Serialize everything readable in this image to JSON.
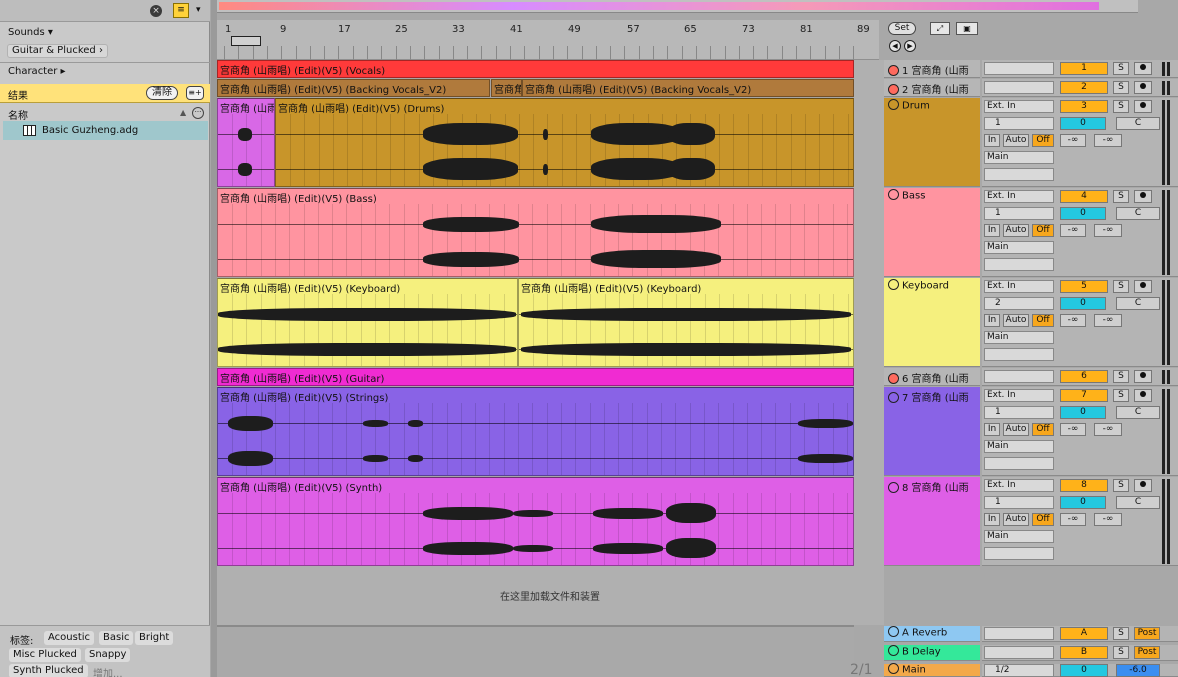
{
  "sidebar": {
    "category_sounds": "Sounds ▾",
    "category_guitar": "Guitar & Plucked ›",
    "category_character": "Character ▸",
    "results_label": "结果",
    "clear_label": "清除",
    "name_header": "名称",
    "result_file": "Basic Guzheng.adg",
    "tags_label": "标签:",
    "tags": [
      "Acoustic",
      "Basic",
      "Bright",
      "Misc Plucked",
      "Snappy",
      "Synth Plucked"
    ],
    "add_tag": "增加..."
  },
  "ruler": {
    "bars": [
      "1",
      "9",
      "17",
      "25",
      "33",
      "41",
      "49",
      "57",
      "65",
      "73",
      "81",
      "89"
    ],
    "set_label": "Set"
  },
  "drop_hint": "在这里加载文件和装置",
  "tracks": [
    {
      "num": "1",
      "header": "1 宫商角 (山雨",
      "clips": [
        "宫商角 (山雨唱) (Edit)(V5) (Vocals)"
      ],
      "vol": "1",
      "color": "#ff3a3a"
    },
    {
      "num": "2",
      "header": "2 宫商角 (山雨",
      "clips": [
        "宫商角 (山雨唱) (Edit)(V5) (Backing Vocals_V2)",
        "宫商角",
        "宫商角 (山雨唱) (Edit)(V5) (Backing Vocals_V2)"
      ],
      "vol": "2",
      "color": "#b07a3c"
    },
    {
      "num": "3",
      "header": "Drum",
      "clips": [
        "宫商角 (山雨",
        "宫商角 (山雨唱) (Edit)(V5) (Drums)"
      ],
      "vol": "3",
      "input": "Ext. In",
      "channel": "1",
      "color": "#c8952a"
    },
    {
      "num": "4",
      "header": "Bass",
      "clips": [
        "宫商角 (山雨唱) (Edit)(V5) (Bass)"
      ],
      "vol": "4",
      "input": "Ext. In",
      "channel": "1",
      "color": "#ff94a0"
    },
    {
      "num": "5",
      "header": "Keyboard",
      "clips": [
        "宫商角 (山雨唱) (Edit)(V5) (Keyboard)",
        "宫商角 (山雨唱) (Edit)(V5) (Keyboard)"
      ],
      "vol": "5",
      "input": "Ext. In",
      "channel": "2",
      "color": "#f5f07e"
    },
    {
      "num": "6",
      "header": "6 宫商角 (山雨",
      "clips": [
        "宫商角 (山雨唱) (Edit)(V5) (Guitar)"
      ],
      "vol": "6",
      "color": "#f02bd2"
    },
    {
      "num": "7",
      "header": "7 宫商角 (山雨",
      "clips": [
        "宫商角 (山雨唱) (Edit)(V5) (Strings)"
      ],
      "vol": "7",
      "input": "Ext. In",
      "channel": "1",
      "color": "#8963e6"
    },
    {
      "num": "8",
      "header": "8 宫商角 (山雨",
      "clips": [
        "宫商角 (山雨唱) (Edit)(V5) (Synth)"
      ],
      "vol": "8",
      "input": "Ext. In",
      "channel": "1",
      "color": "#de5fe6"
    }
  ],
  "mixer": {
    "in": "In",
    "auto": "Auto",
    "off": "Off",
    "main": "Main",
    "neg_inf": "-∞",
    "s": "S",
    "c": "C",
    "zero": "0"
  },
  "returns": [
    {
      "header": "A Reverb",
      "letter": "A",
      "post": "Post",
      "color": "#8ec8f2"
    },
    {
      "header": "B Delay",
      "letter": "B",
      "post": "Post",
      "color": "#34e89a"
    }
  ],
  "main": {
    "header": "Main",
    "routing": "1/2",
    "zero": "0",
    "vol": "-6.0",
    "counter": "2/1"
  }
}
